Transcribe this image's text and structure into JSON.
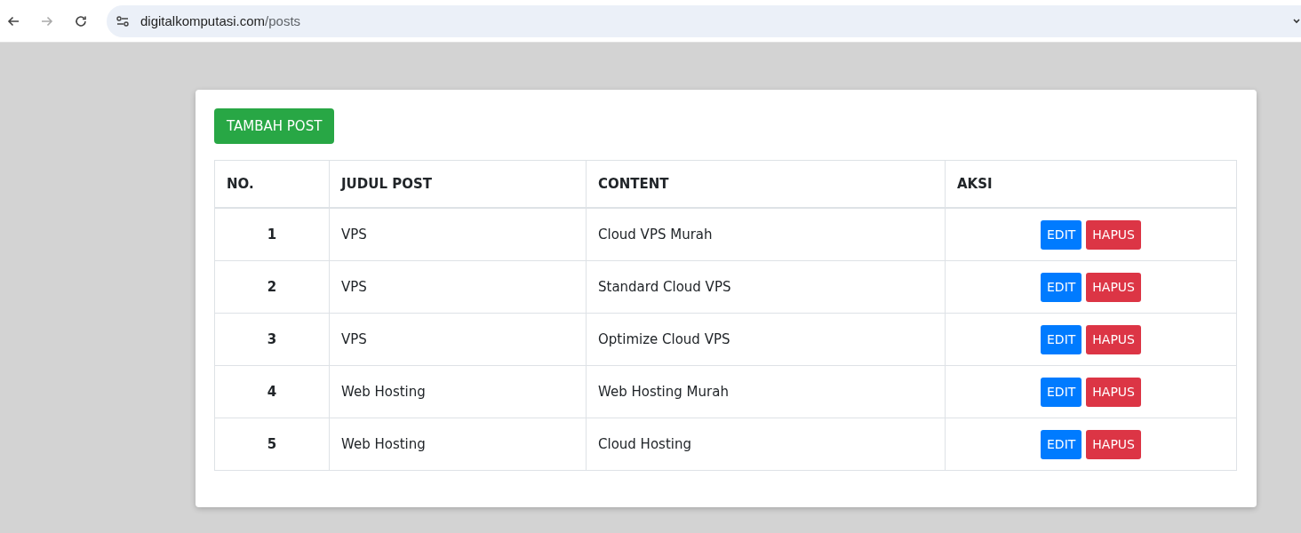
{
  "browser": {
    "url_domain": "digitalkomputasi.com",
    "url_path": "/posts"
  },
  "add_button": "TAMBAH POST",
  "table": {
    "columns": [
      "NO.",
      "JUDUL POST",
      "CONTENT",
      "AKSI"
    ],
    "rows": [
      {
        "no": "1",
        "title": "VPS",
        "content": "Cloud VPS Murah",
        "edit": "EDIT",
        "delete": "HAPUS"
      },
      {
        "no": "2",
        "title": "VPS",
        "content": "Standard Cloud VPS",
        "edit": "EDIT",
        "delete": "HAPUS"
      },
      {
        "no": "3",
        "title": "VPS",
        "content": "Optimize Cloud VPS",
        "edit": "EDIT",
        "delete": "HAPUS"
      },
      {
        "no": "4",
        "title": "Web Hosting",
        "content": "Web Hosting Murah",
        "edit": "EDIT",
        "delete": "HAPUS"
      },
      {
        "no": "5",
        "title": "Web Hosting",
        "content": "Cloud Hosting",
        "edit": "EDIT",
        "delete": "HAPUS"
      }
    ]
  }
}
